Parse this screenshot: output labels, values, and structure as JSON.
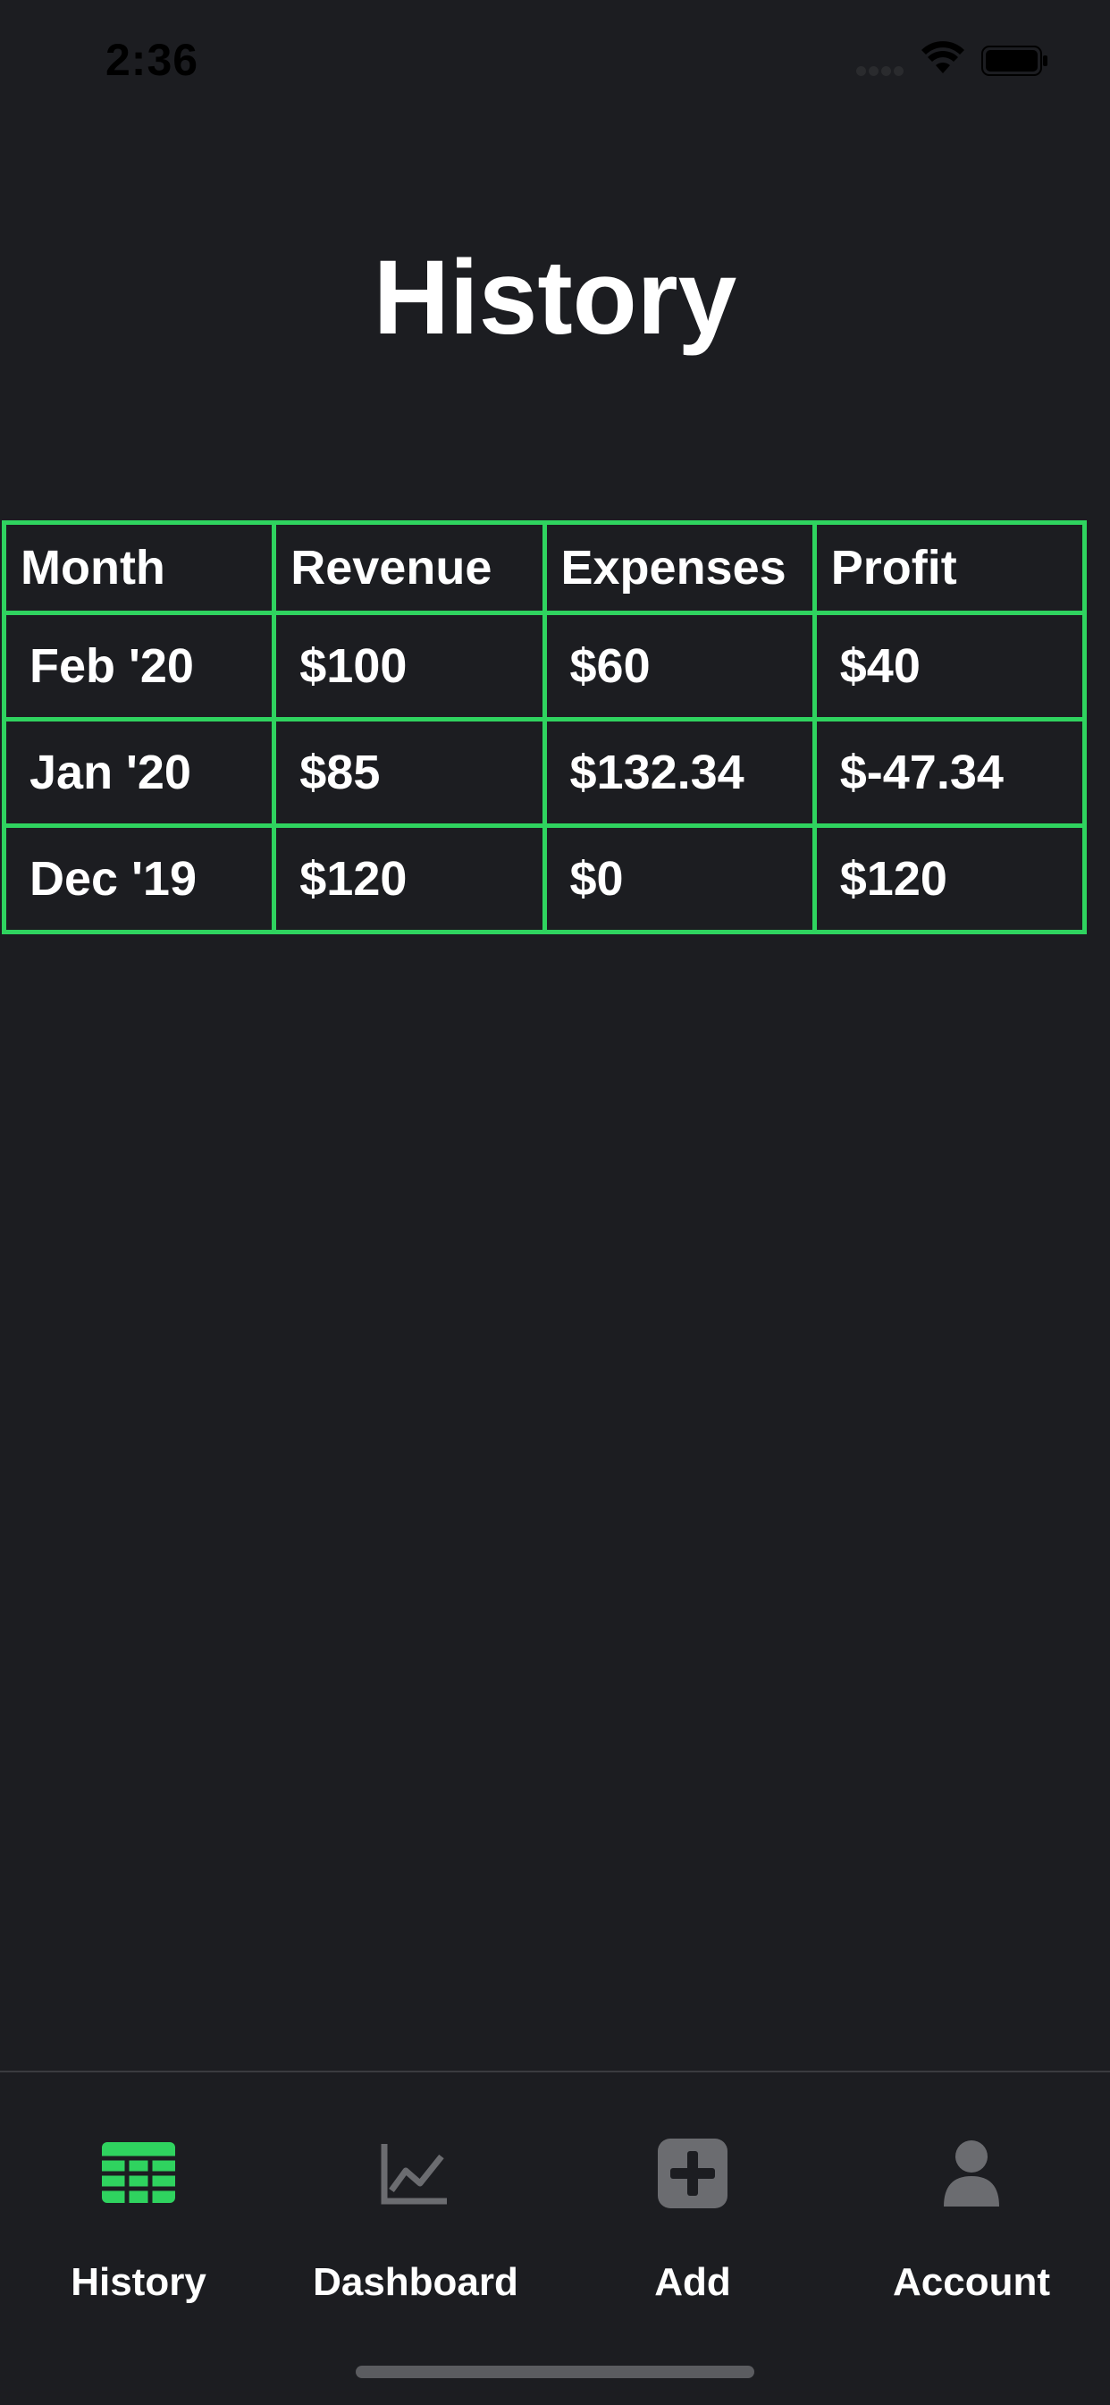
{
  "status_bar": {
    "time": "2:36"
  },
  "page": {
    "title": "History"
  },
  "table": {
    "headers": [
      "Month",
      "Revenue",
      "Expenses",
      "Profit"
    ],
    "rows": [
      [
        "Feb '20",
        "$100",
        "$60",
        "$40"
      ],
      [
        "Jan '20",
        "$85",
        "$132.34",
        "$-47.34"
      ],
      [
        "Dec '19",
        "$120",
        "$0",
        "$120"
      ]
    ]
  },
  "tab_bar": {
    "items": [
      {
        "label": "History",
        "icon": "table-grid-icon",
        "active": true
      },
      {
        "label": "Dashboard",
        "icon": "line-chart-icon",
        "active": false
      },
      {
        "label": "Add",
        "icon": "plus-square-icon",
        "active": false
      },
      {
        "label": "Account",
        "icon": "user-icon",
        "active": false
      }
    ]
  },
  "colors": {
    "background": "#1c1d21",
    "accent": "#2fd35f",
    "inactive_icon": "#6b6c70",
    "text": "#ffffff"
  }
}
